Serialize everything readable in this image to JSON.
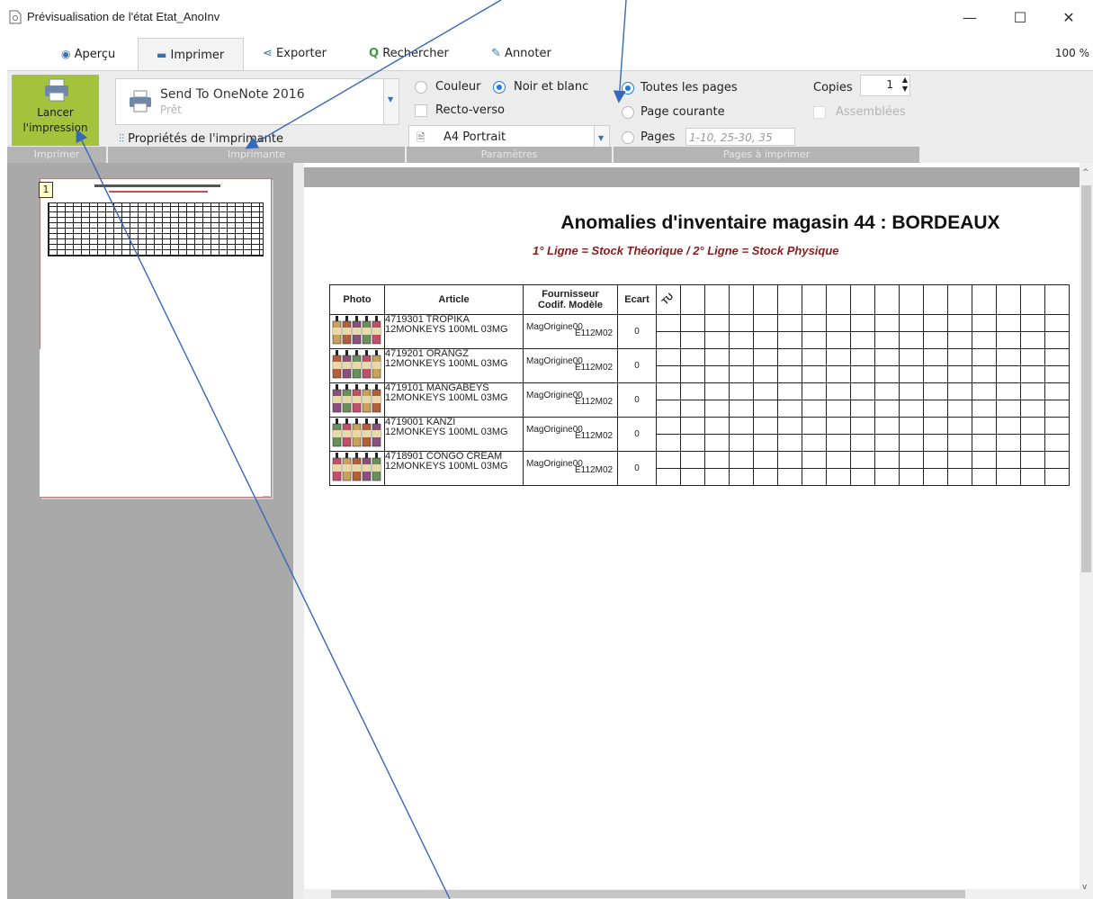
{
  "window": {
    "title": "Prévisualisation de l'état Etat_AnoInv",
    "zoom": "100 %"
  },
  "tabs": [
    "Aperçu",
    "Imprimer",
    "Exporter",
    "Rechercher",
    "Annoter"
  ],
  "ribbon": {
    "print_button": {
      "line1": "Lancer",
      "line2": "l'impression"
    },
    "printer": {
      "name": "Send To OneNote 2016",
      "status": "Prêt",
      "properties": "Propriétés de l'imprimante"
    },
    "color": {
      "couleur": "Couleur",
      "noir_blanc": "Noir et blanc",
      "selected": "Noir et blanc"
    },
    "recto_verso": "Recto-verso",
    "format": "A4 Portrait",
    "pages": {
      "all": "Toutes les pages",
      "current": "Page courante",
      "range": "Pages",
      "range_placeholder": "1-10, 25-30, 35",
      "selected": "Toutes les pages"
    },
    "copies": {
      "label": "Copies",
      "value": "1",
      "collate": "Assemblées"
    },
    "groups": [
      "Imprimer",
      "Imprimante",
      "Paramètres",
      "Pages à imprimer"
    ]
  },
  "thumbnail": {
    "page_number": "1"
  },
  "report": {
    "title": "Anomalies d'inventaire magasin 44 : BORDEAUX",
    "subtitle": "1° Ligne = Stock Théorique / 2° Ligne = Stock Physique",
    "headers": {
      "photo": "Photo",
      "article": "Article",
      "supplier1": "Fournisseur",
      "supplier2": "Codif. Modèle",
      "ecart": "Ecart",
      "size": "TU"
    },
    "rows": [
      {
        "line1": "4719301 TROPIKA",
        "line2": "12MONKEYS 100ML 03MG",
        "supplier_a": "MagOrigine00",
        "supplier_b": "E112M02",
        "ecart": "0"
      },
      {
        "line1": "4719201 ORANGZ",
        "line2": "12MONKEYS 100ML 03MG",
        "supplier_a": "MagOrigine00",
        "supplier_b": "E112M02",
        "ecart": "0"
      },
      {
        "line1": "4719101 MANGABEYS",
        "line2": "12MONKEYS 100ML 03MG",
        "supplier_a": "MagOrigine00",
        "supplier_b": "E112M02",
        "ecart": "0"
      },
      {
        "line1": "4719001 KANZI",
        "line2": "12MONKEYS 100ML 03MG",
        "supplier_a": "MagOrigine00",
        "supplier_b": "E112M02",
        "ecart": "0"
      },
      {
        "line1": "4718901 CONGO CREAM",
        "line2": "12MONKEYS 100ML 03MG",
        "supplier_a": "MagOrigine00",
        "supplier_b": "E112M02",
        "ecart": "0"
      }
    ]
  }
}
